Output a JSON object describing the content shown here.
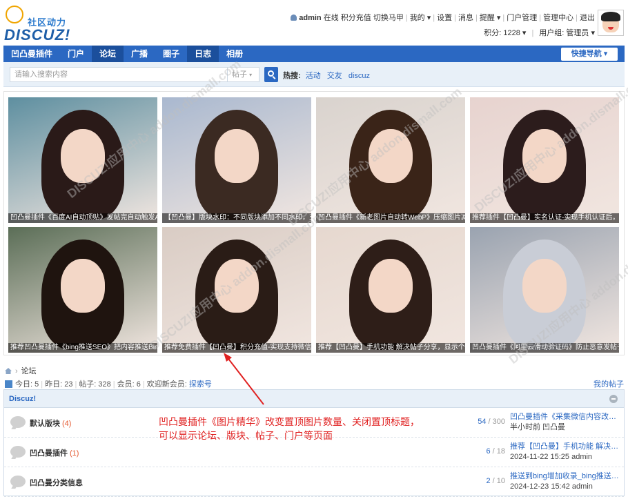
{
  "logo": {
    "cn": "社区动力",
    "en": "DISCUZ!"
  },
  "user": {
    "name": "admin",
    "status": "在线",
    "links": [
      "积分充值",
      "切换马甲"
    ],
    "menu": [
      "我的",
      "设置",
      "消息",
      "提醒",
      "门户管理",
      "管理中心",
      "退出"
    ],
    "credits": "积分: 1228",
    "group": "用户组: 管理员"
  },
  "nav": {
    "items": [
      "凹凸曼插件",
      "门户",
      "论坛",
      "广播",
      "圈子",
      "日志",
      "相册"
    ],
    "active_index": 2,
    "quick": "快捷导航"
  },
  "search": {
    "placeholder": "请输入搜索内容",
    "type": "帖子",
    "hot_label": "热搜:",
    "hot": [
      "活动",
      "交友",
      "discuz"
    ]
  },
  "grid": {
    "tiles": [
      {
        "caption": "凹凸曼插件《百度AI自动顶贴》发帖完自动触发AI自",
        "bg": "#5e8fa0",
        "hair": "#2a1a18"
      },
      {
        "caption": "【凹凸曼】版块水印：不同版块添加不同水印，支持",
        "bg": "#a9b8cf",
        "hair": "#3b2a22"
      },
      {
        "caption": "凹凸曼插件《新老图片自动转WebP》压缩图片减少覆",
        "bg": "#d9d3ce",
        "hair": "#3a2418"
      },
      {
        "caption": "推荐插件【凹凸曼】实名认证-实现手机认证后，才能",
        "bg": "#e7d3cf",
        "hair": "#2c1c1c"
      },
      {
        "caption": "推荐凹凸曼插件《bing推送SEO》把内容推送Bing搜索",
        "bg": "#5b6e57",
        "hair": "#1f140f"
      },
      {
        "caption": "推荐免费插件【凹凸曼】积分充值-实现支持微信、支付",
        "bg": "#d9ccc4",
        "hair": "#2a1c16"
      },
      {
        "caption": "推荐【凹凸曼】手机功能 解决帖子分享，显示个人",
        "bg": "#e6d8cf",
        "hair": "#2e1e18"
      },
      {
        "caption": "凹凸曼插件《阿里云滑动验证码》防止恶意发帖子",
        "bg": "#9aa3b0",
        "hair": "#c9cdd6"
      }
    ]
  },
  "watermark": "DISCUZ!应用中心 addon.dismall.com",
  "breadcrumb": "论坛",
  "stats": {
    "today": "今日: 5",
    "yesterday": "昨日: 23",
    "posts": "帖子: 328",
    "members": "会员: 6",
    "welcome": "欢迎新会员:",
    "newest": "探索号",
    "myposts": "我的帖子"
  },
  "forum": {
    "category": "Discuz!",
    "rows": [
      {
        "name": "默认版块",
        "count": "(4)",
        "threads": "54",
        "posts": "300",
        "last_title": "凹凸曼插件《采集微信内容改写》",
        "last_meta": "半小时前 凹凸曼"
      },
      {
        "name": "凹凸曼插件",
        "count": "(1)",
        "threads": "6",
        "posts": "18",
        "last_title": "推荐【凹凸曼】手机功能 解决帖 ...",
        "last_meta": "2024-11-22 15:25 admin"
      },
      {
        "name": "凹凸曼分类信息",
        "count": "",
        "threads": "2",
        "posts": "10",
        "last_title": "推送到bing增加收录_bing推送SEO ...",
        "last_meta": "2024-12-23 15:42 admin"
      }
    ]
  },
  "annotation": [
    "凹凸曼插件《图片精华》改变置顶图片数量、关闭置顶标题，",
    "可以显示论坛、版块、帖子、门户等页面"
  ],
  "colors": {
    "nav": "#2b68c2",
    "accent": "#e02020",
    "link": "#2b68c2"
  }
}
